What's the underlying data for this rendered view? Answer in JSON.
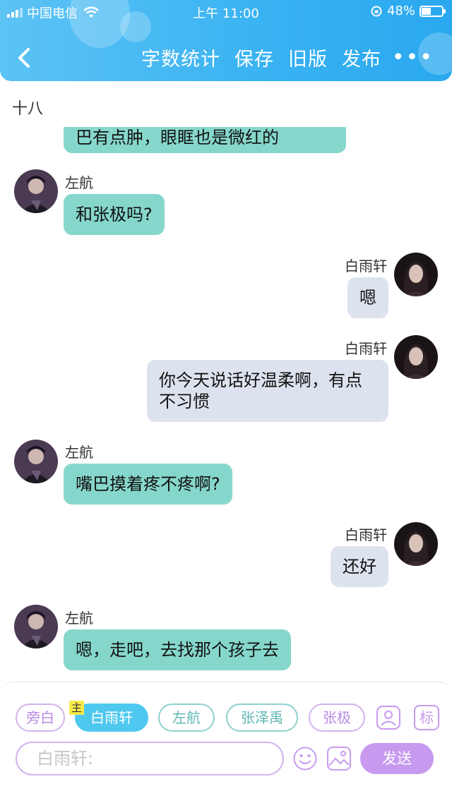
{
  "status_bar": {
    "carrier": "中国电信",
    "time": "上午 11:00",
    "battery": "48%",
    "battery_level": 0.48
  },
  "nav": {
    "actions": [
      "字数统计",
      "保存",
      "旧版",
      "发布"
    ],
    "more": "•••"
  },
  "section_title": "十八",
  "messages": [
    {
      "side": "left",
      "sender": "",
      "text": "巴有点肿，眼眶也是微红的"
    },
    {
      "side": "left",
      "sender": "左航",
      "text": "和张极吗?"
    },
    {
      "side": "right",
      "sender": "白雨轩",
      "text": "嗯"
    },
    {
      "side": "right",
      "sender": "白雨轩",
      "text": "你今天说话好温柔啊，有点不习惯"
    },
    {
      "side": "left",
      "sender": "左航",
      "text": "嘴巴摸着疼不疼啊?"
    },
    {
      "side": "right",
      "sender": "白雨轩",
      "text": "还好"
    },
    {
      "side": "left",
      "sender": "左航",
      "text": "嗯，走吧，去找那个孩子去"
    }
  ],
  "composer": {
    "characters": [
      "旁白",
      "白雨轩",
      "左航",
      "张泽禹",
      "张极"
    ],
    "active_character": "白雨轩",
    "main_tag": "主",
    "role_icon_label": "",
    "tag_button": "标",
    "input_value": "白雨轩:",
    "send_label": "发送"
  },
  "colors": {
    "header": "#38b2f2",
    "left_bubble": "#86d7cb",
    "right_bubble": "#dde3ee",
    "send": "#c79af0",
    "chip_active": "#4fc8f0"
  }
}
